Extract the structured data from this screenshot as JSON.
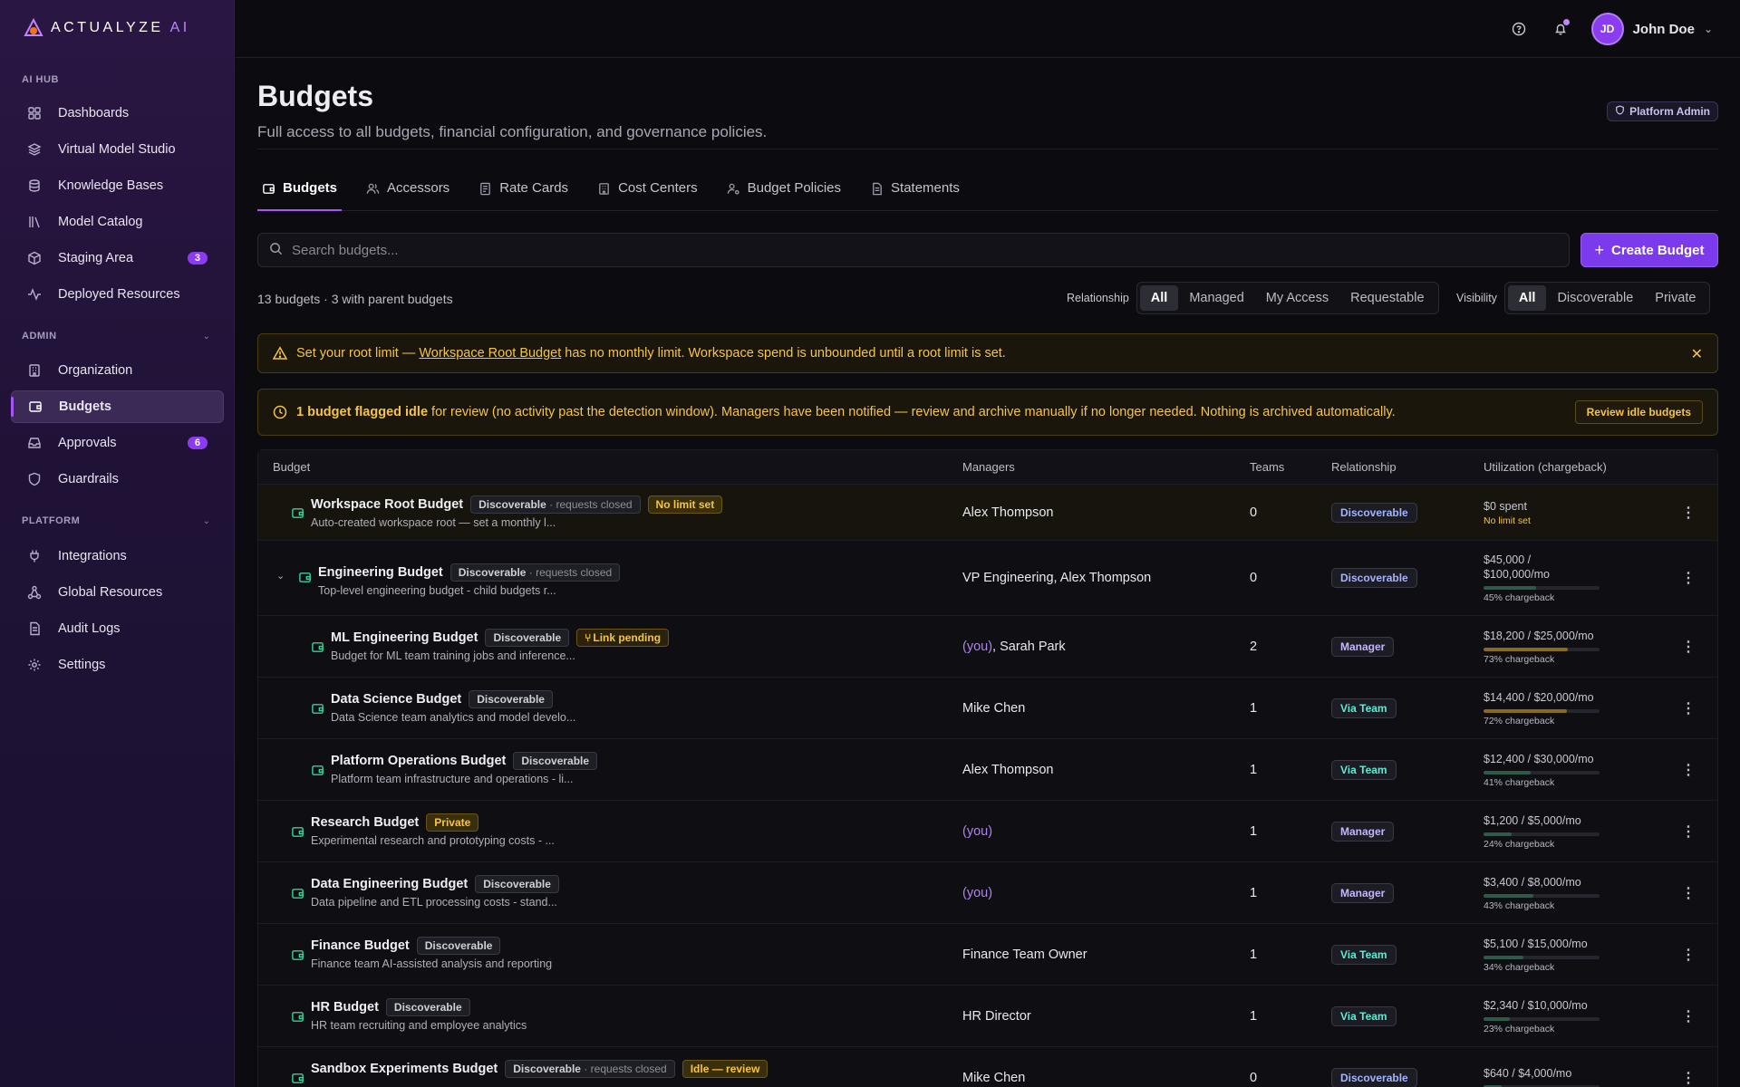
{
  "app": {
    "brand": "ACTUALYZE",
    "brand_suffix": "AI"
  },
  "sidebar": {
    "sections": [
      {
        "label": "AI HUB"
      },
      {
        "label": "ADMIN"
      },
      {
        "label": "PLATFORM"
      }
    ],
    "items": [
      {
        "label": "Dashboards",
        "icon": "grid-icon"
      },
      {
        "label": "Virtual Model Studio",
        "icon": "layers-icon"
      },
      {
        "label": "Knowledge Bases",
        "icon": "database-icon"
      },
      {
        "label": "Model Catalog",
        "icon": "library-icon"
      },
      {
        "label": "Staging Area",
        "icon": "cube-icon",
        "badge": "3"
      },
      {
        "label": "Deployed Resources",
        "icon": "activity-icon"
      },
      {
        "label": "Organization",
        "icon": "building-icon"
      },
      {
        "label": "Budgets",
        "icon": "wallet-icon"
      },
      {
        "label": "Approvals",
        "icon": "inbox-icon",
        "badge": "6"
      },
      {
        "label": "Guardrails",
        "icon": "shield-icon"
      },
      {
        "label": "Integrations",
        "icon": "plug-icon"
      },
      {
        "label": "Global Resources",
        "icon": "network-icon"
      },
      {
        "label": "Audit Logs",
        "icon": "file-icon"
      },
      {
        "label": "Settings",
        "icon": "gear-icon"
      }
    ]
  },
  "topbar": {
    "user_initials": "JD",
    "user_name": "John Doe"
  },
  "page": {
    "title": "Budgets",
    "subtitle": "Full access to all budgets, financial configuration, and governance policies.",
    "role_badge": "Platform Admin"
  },
  "tabs": [
    {
      "label": "Budgets",
      "icon": "wallet-icon"
    },
    {
      "label": "Accessors",
      "icon": "users-icon"
    },
    {
      "label": "Rate Cards",
      "icon": "card-icon"
    },
    {
      "label": "Cost Centers",
      "icon": "building-icon"
    },
    {
      "label": "Budget Policies",
      "icon": "user-cog-icon"
    },
    {
      "label": "Statements",
      "icon": "file-icon"
    }
  ],
  "search": {
    "placeholder": "Search budgets..."
  },
  "create_button": "Create Budget",
  "summary": "13 budgets · 3 with parent budgets",
  "filters": {
    "relationship": {
      "label": "Relationship",
      "options": [
        "All",
        "Managed",
        "My Access",
        "Requestable"
      ],
      "selected": "All"
    },
    "visibility": {
      "label": "Visibility",
      "options": [
        "All",
        "Discoverable",
        "Private"
      ],
      "selected": "All"
    }
  },
  "alerts": {
    "root": {
      "prefix": "Set your root limit — ",
      "link": "Workspace Root Budget",
      "suffix": " has no monthly limit. Workspace spend is unbounded until a root limit is set."
    },
    "idle": {
      "bold": "1 budget flagged idle",
      "text": " for review (no activity past the detection window). Managers have been notified — review and archive manually if no longer needed. Nothing is archived automatically.",
      "button": "Review idle budgets"
    }
  },
  "table": {
    "headers": {
      "budget": "Budget",
      "managers": "Managers",
      "teams": "Teams",
      "relationship": "Relationship",
      "utilization": "Utilization (chargeback)"
    },
    "rows": [
      {
        "name": "Workspace Root Budget",
        "desc": "Auto-created workspace root — set a monthly l...",
        "vis": "Discoverable",
        "vis_sub": " · requests closed",
        "extra": "No limit set",
        "managers": "Alex Thompson",
        "teams": "0",
        "relationship": "Discoverable",
        "util_amount": "$0 spent",
        "util_note": "No limit set"
      },
      {
        "name": "Engineering Budget",
        "desc": "Top-level engineering budget - child budgets r...",
        "vis": "Discoverable",
        "vis_sub": " · requests closed",
        "managers": "VP Engineering, Alex Thompson",
        "teams": "0",
        "relationship": "Discoverable",
        "util_amount1": "$45,000 /",
        "util_amount2": "$100,000/mo",
        "util_pct": "45% chargeback",
        "pct": 45
      },
      {
        "name": "ML Engineering Budget",
        "desc": "Budget for ML team training jobs and inference...",
        "vis": "Discoverable",
        "extra": "Link pending",
        "managers_you": "(you)",
        "managers": ", Sarah Park",
        "teams": "2",
        "relationship": "Manager",
        "util_amount": "$18,200 / $25,000/mo",
        "util_pct": "73% chargeback",
        "pct": 73
      },
      {
        "name": "Data Science Budget",
        "desc": "Data Science team analytics and model develo...",
        "vis": "Discoverable",
        "managers": "Mike Chen",
        "teams": "1",
        "relationship": "Via Team",
        "util_amount": "$14,400 / $20,000/mo",
        "util_pct": "72% chargeback",
        "pct": 72
      },
      {
        "name": "Platform Operations Budget",
        "desc": "Platform team infrastructure and operations - li...",
        "vis": "Discoverable",
        "managers": "Alex Thompson",
        "teams": "1",
        "relationship": "Via Team",
        "util_amount": "$12,400 / $30,000/mo",
        "util_pct": "41% chargeback",
        "pct": 41
      },
      {
        "name": "Research Budget",
        "desc": "Experimental research and prototyping costs - ...",
        "vis": "Private",
        "managers_you": "(you)",
        "teams": "1",
        "relationship": "Manager",
        "util_amount": "$1,200 / $5,000/mo",
        "util_pct": "24% chargeback",
        "pct": 24
      },
      {
        "name": "Data Engineering Budget",
        "desc": "Data pipeline and ETL processing costs - stand...",
        "vis": "Discoverable",
        "managers_you": "(you)",
        "teams": "1",
        "relationship": "Manager",
        "util_amount": "$3,400 / $8,000/mo",
        "util_pct": "43% chargeback",
        "pct": 43
      },
      {
        "name": "Finance Budget",
        "desc": "Finance team AI-assisted analysis and reporting",
        "vis": "Discoverable",
        "managers": "Finance Team Owner",
        "teams": "1",
        "relationship": "Via Team",
        "util_amount": "$5,100 / $15,000/mo",
        "util_pct": "34% chargeback",
        "pct": 34
      },
      {
        "name": "HR Budget",
        "desc": "HR team recruiting and employee analytics",
        "vis": "Discoverable",
        "managers": "HR Director",
        "teams": "1",
        "relationship": "Via Team",
        "util_amount": "$2,340 / $10,000/mo",
        "util_pct": "23% chargeback",
        "pct": 23
      },
      {
        "name": "Sandbox Experiments Budget",
        "desc": "",
        "vis": "Discoverable",
        "vis_sub": " · requests closed",
        "extra": "Idle — review",
        "managers": "Mike Chen",
        "teams": "0",
        "relationship": "Discoverable",
        "util_amount": "$640 / $4,000/mo",
        "pct": 16
      }
    ]
  },
  "colors": {
    "accent": "#7c3aed",
    "warning": "#f5c542",
    "success": "#34d399",
    "bar_high": "#8a6a1c",
    "bar_normal": "#2f5a4a"
  }
}
